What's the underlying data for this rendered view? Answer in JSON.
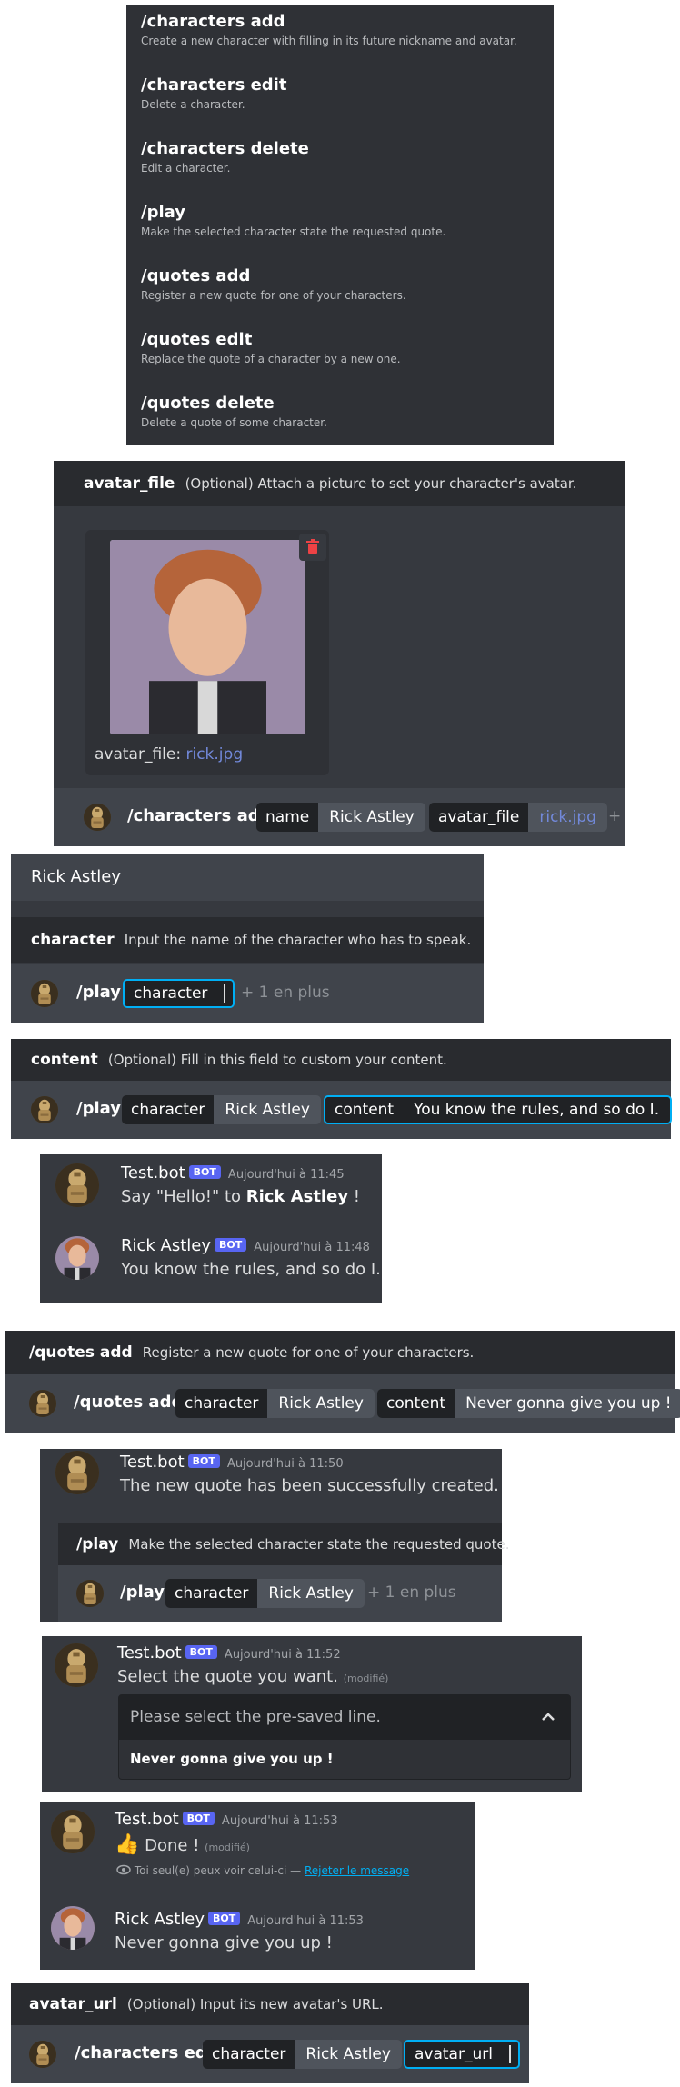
{
  "commands": [
    {
      "name": "/characters add",
      "desc": "Create a new character with filling in its future nickname and avatar."
    },
    {
      "name": "/characters edit",
      "desc": "Delete a character."
    },
    {
      "name": "/characters delete",
      "desc": "Edit a character."
    },
    {
      "name": "/play",
      "desc": "Make the selected character state the requested quote."
    },
    {
      "name": "/quotes add",
      "desc": "Register a new quote for one of your characters."
    },
    {
      "name": "/quotes edit",
      "desc": "Replace the quote of a character by a new one."
    },
    {
      "name": "/quotes delete",
      "desc": "Delete a quote of some character."
    }
  ],
  "attach": {
    "opt_name": "avatar_file",
    "opt_desc": "(Optional) Attach a picture to set your character's avatar.",
    "file_label": "avatar_file:",
    "file_name": "rick.jpg",
    "cmd": "/characters add",
    "chip1_key": "name",
    "chip1_val": "Rick Astley",
    "chip2_key": "avatar_file",
    "chip2_val": "rick.jpg",
    "plus": "+",
    "trash_icon": "trash-icon"
  },
  "play1": {
    "suggestion": "Rick Astley",
    "opt_name": "character",
    "opt_desc": "Input the name of the character who has to speak.",
    "cmd": "/play",
    "chip_key": "character",
    "more": "+ 1 en plus"
  },
  "play2": {
    "opt_name": "content",
    "opt_desc": "(Optional) Fill in this field to custom your content.",
    "cmd": "/play",
    "chip1_key": "character",
    "chip1_val": "Rick Astley",
    "chip2_key": "content",
    "chip2_val": "You know the rules, and so do I."
  },
  "chat1": {
    "m1_author": "Test.bot",
    "m1_badge": "BOT",
    "m1_time": "Aujourd'hui à 11:45",
    "m1_pre": "Say \"Hello!\" to ",
    "m1_bold": "Rick Astley",
    "m1_post": " !",
    "m2_author": "Rick Astley",
    "m2_badge": "BOT",
    "m2_time": "Aujourd'hui à 11:48",
    "m2_text": "You know the rules, and so do I."
  },
  "quotes_add": {
    "opt_name": "/quotes add",
    "opt_desc": "Register a new quote for one of your characters.",
    "cmd": "/quotes add",
    "chip1_key": "character",
    "chip1_val": "Rick Astley",
    "chip2_key": "content",
    "chip2_val": "Never gonna give you up !"
  },
  "chat2": {
    "author": "Test.bot",
    "badge": "BOT",
    "time": "Aujourd'hui à 11:50",
    "text": "The new quote has been successfully created.",
    "opt_name": "/play",
    "opt_desc": "Make the selected character state the requested quote.",
    "cmd": "/play",
    "chip_key": "character",
    "chip_val": "Rick Astley",
    "more": "+ 1 en plus"
  },
  "chat3": {
    "author": "Test.bot",
    "badge": "BOT",
    "time": "Aujourd'hui à 11:52",
    "text": "Select the quote you want.",
    "edited": "(modifié)",
    "placeholder": "Please select the pre-saved line.",
    "option": "Never gonna give you up !",
    "chevron_icon": "chevron-up-icon"
  },
  "chat4": {
    "author": "Test.bot",
    "badge": "BOT",
    "time": "Aujourd'hui à 11:53",
    "emoji": "👍",
    "text": "Done !",
    "edited": "(modifié)",
    "ephemeral": "Toi seul(e) peux voir celui-ci —",
    "dismiss": "Rejeter le message",
    "author2": "Rick Astley",
    "badge2": "BOT",
    "time2": "Aujourd'hui à 11:53",
    "text2": "Never gonna give you up !"
  },
  "edit": {
    "opt_name": "avatar_url",
    "opt_desc": "(Optional) Input its new avatar's URL.",
    "cmd": "/characters edit",
    "chip1_key": "character",
    "chip1_val": "Rick Astley",
    "chip2_key": "avatar_url"
  },
  "colors": {
    "accent": "#5865f2",
    "focus": "#00aff4",
    "danger": "#ed4245",
    "link": "#00b0f4"
  }
}
